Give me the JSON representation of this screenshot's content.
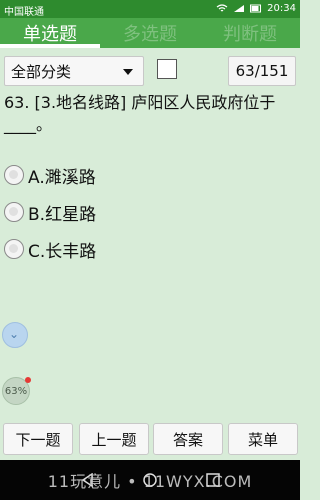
{
  "status_bar": {
    "carrier": "中国联通",
    "time": "20:34"
  },
  "tabs": [
    {
      "label": "单选题",
      "active": true
    },
    {
      "label": "多选题",
      "active": false
    },
    {
      "label": "判断题",
      "active": false
    }
  ],
  "controls": {
    "category_selected": "全部分类",
    "progress_counter": "63/151"
  },
  "question": {
    "text": "63. [3.地名线路] 庐阳区人民政府位于____。"
  },
  "options": [
    {
      "label": "A.濉溪路"
    },
    {
      "label": "B.红星路"
    },
    {
      "label": "C.长丰路"
    }
  ],
  "floating": {
    "progress_badge": "63%"
  },
  "buttons": {
    "next": "下一题",
    "prev": "上一题",
    "answer": "答案",
    "menu": "菜单"
  },
  "watermark": "11玩意儿 • 11WYX.COM",
  "colors": {
    "tab_bg": "#4aa84a",
    "status_bar": "#2e8b2e",
    "background": "#d8ecd8"
  }
}
